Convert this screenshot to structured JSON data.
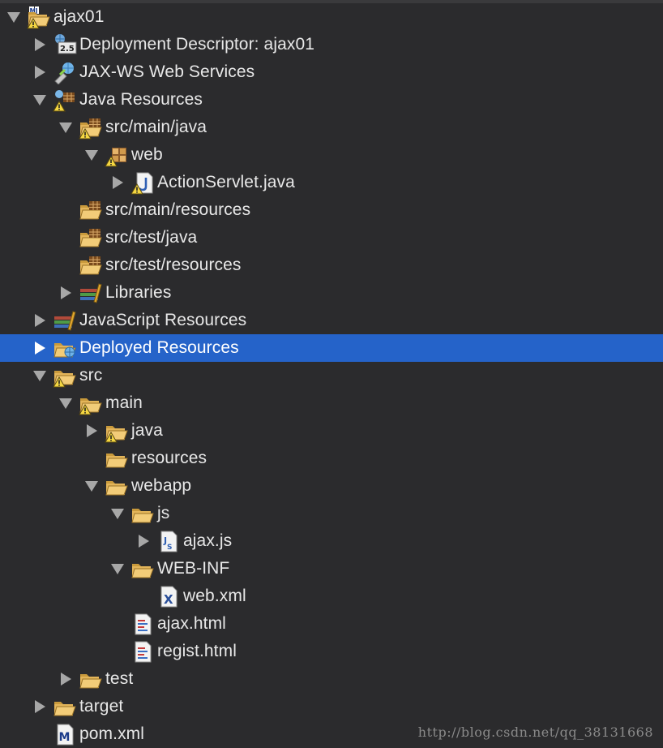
{
  "tree": [
    {
      "label": "ajax01",
      "depth": 0,
      "expanded": true,
      "icon": "maven-project-icon",
      "warn": true
    },
    {
      "label": "Deployment Descriptor: ajax01",
      "depth": 1,
      "expanded": false,
      "icon": "deployment-descriptor-icon",
      "badge": "2.5"
    },
    {
      "label": "JAX-WS Web Services",
      "depth": 1,
      "expanded": false,
      "icon": "web-services-icon"
    },
    {
      "label": "Java Resources",
      "depth": 1,
      "expanded": true,
      "icon": "java-resources-icon",
      "warn": true
    },
    {
      "label": "src/main/java",
      "depth": 2,
      "expanded": true,
      "icon": "source-folder-icon",
      "warn": true
    },
    {
      "label": "web",
      "depth": 3,
      "expanded": true,
      "icon": "package-icon",
      "warn": true
    },
    {
      "label": "ActionServlet.java",
      "depth": 4,
      "expanded": false,
      "icon": "java-file-icon",
      "warn": true
    },
    {
      "label": "src/main/resources",
      "depth": 2,
      "expanded": null,
      "icon": "source-folder-icon"
    },
    {
      "label": "src/test/java",
      "depth": 2,
      "expanded": null,
      "icon": "source-folder-icon"
    },
    {
      "label": "src/test/resources",
      "depth": 2,
      "expanded": null,
      "icon": "source-folder-icon"
    },
    {
      "label": "Libraries",
      "depth": 2,
      "expanded": false,
      "icon": "libraries-icon"
    },
    {
      "label": "JavaScript Resources",
      "depth": 1,
      "expanded": false,
      "icon": "libraries-icon"
    },
    {
      "label": "Deployed Resources",
      "depth": 1,
      "expanded": false,
      "icon": "deployed-resources-icon",
      "selected": true
    },
    {
      "label": "src",
      "depth": 1,
      "expanded": true,
      "icon": "folder-open-icon",
      "warn": true
    },
    {
      "label": "main",
      "depth": 2,
      "expanded": true,
      "icon": "folder-open-icon",
      "warn": true
    },
    {
      "label": "java",
      "depth": 3,
      "expanded": false,
      "icon": "folder-open-icon",
      "warn": true
    },
    {
      "label": "resources",
      "depth": 3,
      "expanded": null,
      "icon": "folder-open-icon"
    },
    {
      "label": "webapp",
      "depth": 3,
      "expanded": true,
      "icon": "folder-open-icon"
    },
    {
      "label": "js",
      "depth": 4,
      "expanded": true,
      "icon": "folder-open-icon"
    },
    {
      "label": "ajax.js",
      "depth": 5,
      "expanded": false,
      "icon": "js-file-icon"
    },
    {
      "label": "WEB-INF",
      "depth": 4,
      "expanded": true,
      "icon": "folder-open-icon"
    },
    {
      "label": "web.xml",
      "depth": 5,
      "expanded": null,
      "icon": "xml-file-icon"
    },
    {
      "label": "ajax.html",
      "depth": 4,
      "expanded": null,
      "icon": "html-file-icon"
    },
    {
      "label": "regist.html",
      "depth": 4,
      "expanded": null,
      "icon": "html-file-icon"
    },
    {
      "label": "test",
      "depth": 2,
      "expanded": false,
      "icon": "folder-open-icon"
    },
    {
      "label": "target",
      "depth": 1,
      "expanded": false,
      "icon": "folder-open-icon"
    },
    {
      "label": "pom.xml",
      "depth": 1,
      "expanded": null,
      "icon": "maven-file-icon"
    }
  ],
  "watermark": "http://blog.csdn.net/qq_38131668",
  "colors": {
    "background": "#2b2b2d",
    "selection": "#2563c9",
    "text": "#e8e8e8",
    "twisty": "#a7a7a7"
  }
}
